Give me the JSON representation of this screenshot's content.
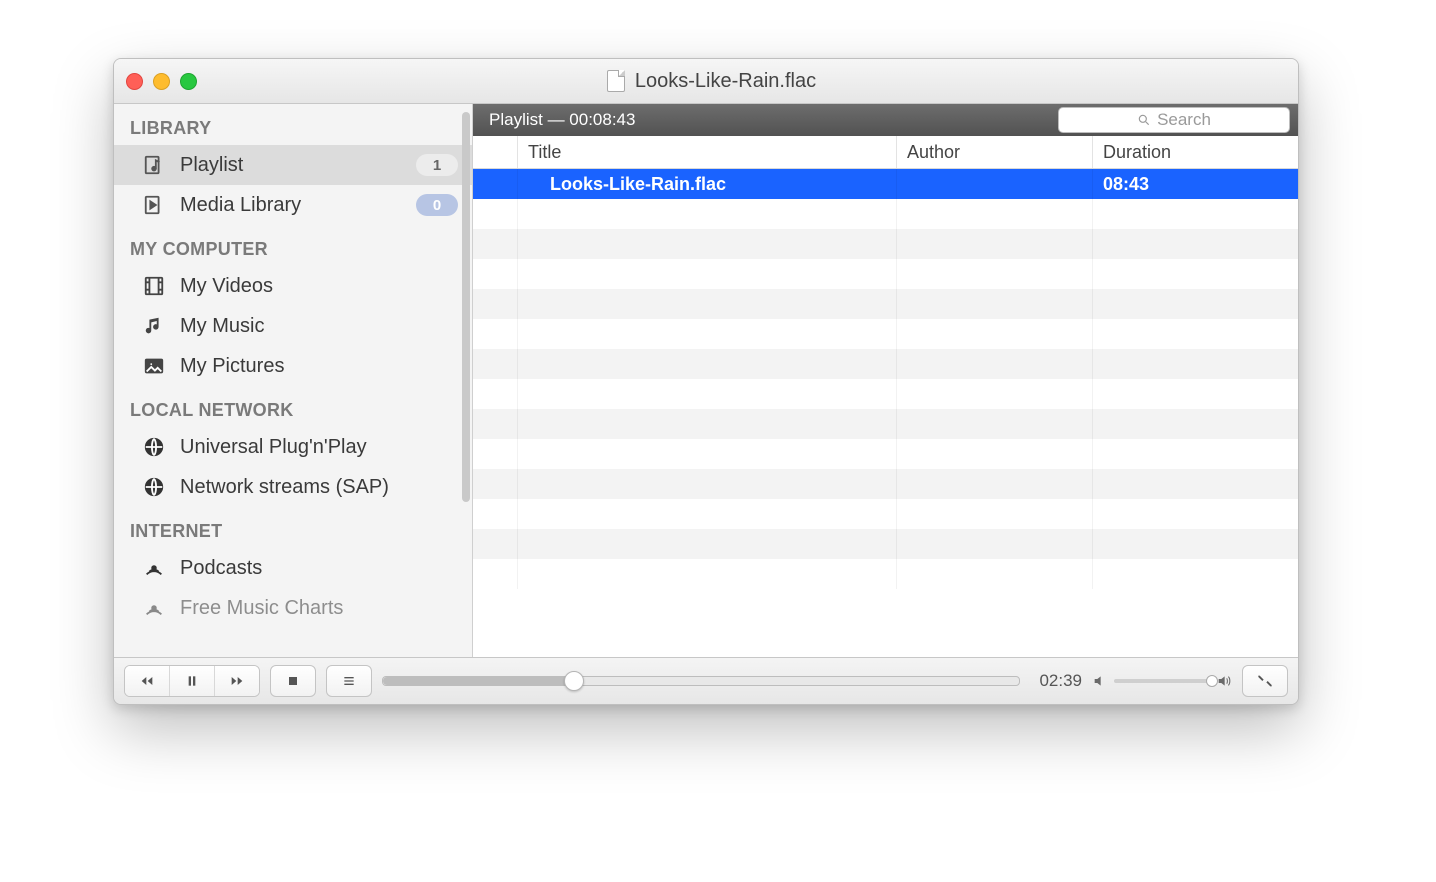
{
  "window": {
    "title": "Looks-Like-Rain.flac"
  },
  "sidebar": {
    "sections": {
      "library": {
        "heading": "LIBRARY",
        "playlist": {
          "label": "Playlist",
          "badge": "1"
        },
        "medialib": {
          "label": "Media Library",
          "badge": "0"
        }
      },
      "computer": {
        "heading": "MY COMPUTER",
        "videos": "My Videos",
        "music": "My Music",
        "pictures": "My Pictures"
      },
      "network": {
        "heading": "LOCAL NETWORK",
        "upnp": "Universal Plug'n'Play",
        "sap": "Network streams (SAP)"
      },
      "internet": {
        "heading": "INTERNET",
        "podcasts": "Podcasts",
        "fmc": "Free Music Charts"
      }
    }
  },
  "playlist_header": {
    "label": "Playlist — 00:08:43"
  },
  "search": {
    "placeholder": "Search"
  },
  "columns": {
    "title": "Title",
    "author": "Author",
    "duration": "Duration"
  },
  "tracks": [
    {
      "title": "Looks-Like-Rain.flac",
      "author": "",
      "duration": "08:43",
      "selected": true
    }
  ],
  "player": {
    "elapsed": "02:39",
    "progress_pct": 30,
    "volume_pct": 90
  }
}
